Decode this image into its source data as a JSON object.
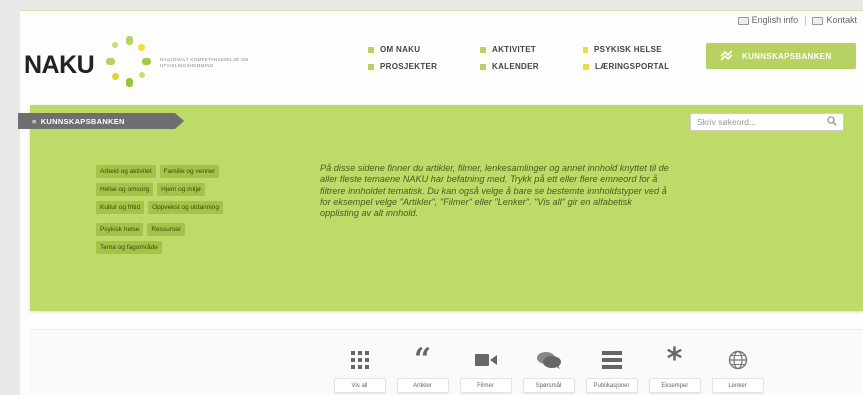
{
  "header": {
    "utility_links": [
      {
        "label": "English info",
        "icon": "flag-icon"
      },
      {
        "label": "Kontakt",
        "icon": "envelope-icon"
      }
    ],
    "logo_text": "NAKU",
    "tagline": "NASJONALT KOMPETANSEMILJØ OM UTVIKLINGSHEMMING",
    "nav": [
      {
        "label": "OM NAKU"
      },
      {
        "label": "AKTIVITET"
      },
      {
        "label": "PSYKISK HELSE"
      },
      {
        "label": "PROSJEKTER"
      },
      {
        "label": "KALENDER"
      },
      {
        "label": "LÆRINGSPORTAL"
      }
    ],
    "kb_button": "KUNNSKAPSBANKEN"
  },
  "panel": {
    "breadcrumb": "KUNNSKAPSBANKEN",
    "search_placeholder": "Skriv søkeord...",
    "tags_group1": [
      [
        "Arbeid og aktivitet",
        "Familie og venner"
      ],
      [
        "Helse og omsorg",
        "Hjem og miljø"
      ],
      [
        "Kultur og fritid",
        "Oppvekst og utdanning"
      ]
    ],
    "tags_group2": [
      [
        "Psykisk helse",
        "Ressurser"
      ],
      [
        "Tema og fagområde"
      ]
    ],
    "intro": "På disse sidene finner du artikler, filmer, lenkesamlinger og annet innhold knyttet til de aller fleste temaene NAKU har befatning med. Trykk på ett eller flere emneord for å filtrere innholdet tematisk. Du kan også velge å bare se bestemte innholdstyper ved å for eksempel velge \"Artikler\", \"Filmer\" eller \"Lenker\". \"Vis all\" gir en alfabetisk opplisting av alt innhold."
  },
  "content_types": [
    {
      "label": "Vis all",
      "icon": "grid-icon"
    },
    {
      "label": "Artikler",
      "icon": "quote-icon"
    },
    {
      "label": "Filmer",
      "icon": "video-camera-icon"
    },
    {
      "label": "Spørsmål",
      "icon": "speech-bubbles-icon"
    },
    {
      "label": "Publikasjoner",
      "icon": "list-icon"
    },
    {
      "label": "Eksempel",
      "icon": "asterisk-icon"
    },
    {
      "label": "Lenker",
      "icon": "globe-icon"
    }
  ],
  "colors": {
    "accent_green": "#bedb6a",
    "tag_green": "#a5c447",
    "breadcrumb_gray": "#6f6f6f"
  }
}
